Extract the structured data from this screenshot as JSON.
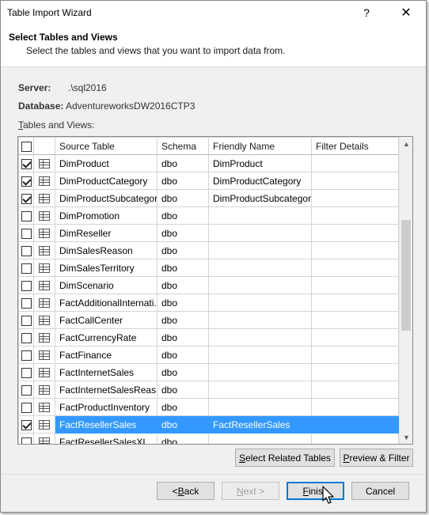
{
  "window": {
    "title": "Table Import Wizard",
    "help_glyph": "?",
    "close_glyph": "✕"
  },
  "header": {
    "title": "Select Tables and Views",
    "subtitle": "Select the tables and views that you want to import data from."
  },
  "info": {
    "server_label": "Server:",
    "server_value": ".\\sql2016",
    "database_label": "Database:",
    "database_value": "AdventureworksDW2016CTP3"
  },
  "tables_label": {
    "prefix": "",
    "accel": "T",
    "rest": "ables and Views:"
  },
  "grid": {
    "columns": [
      "",
      "",
      "Source Table",
      "Schema",
      "Friendly Name",
      "Filter Details"
    ],
    "rows": [
      {
        "checked": true,
        "source": "DimProduct",
        "schema": "dbo",
        "friendly": "DimProduct",
        "filter": "",
        "selected": false
      },
      {
        "checked": true,
        "source": "DimProductCategory",
        "schema": "dbo",
        "friendly": "DimProductCategory",
        "filter": "",
        "selected": false
      },
      {
        "checked": true,
        "source": "DimProductSubcategory",
        "schema": "dbo",
        "friendly": "DimProductSubcategory",
        "filter": "",
        "selected": false
      },
      {
        "checked": false,
        "source": "DimPromotion",
        "schema": "dbo",
        "friendly": "",
        "filter": "",
        "selected": false
      },
      {
        "checked": false,
        "source": "DimReseller",
        "schema": "dbo",
        "friendly": "",
        "filter": "",
        "selected": false
      },
      {
        "checked": false,
        "source": "DimSalesReason",
        "schema": "dbo",
        "friendly": "",
        "filter": "",
        "selected": false
      },
      {
        "checked": false,
        "source": "DimSalesTerritory",
        "schema": "dbo",
        "friendly": "",
        "filter": "",
        "selected": false
      },
      {
        "checked": false,
        "source": "DimScenario",
        "schema": "dbo",
        "friendly": "",
        "filter": "",
        "selected": false
      },
      {
        "checked": false,
        "source": "FactAdditionalInternati...",
        "schema": "dbo",
        "friendly": "",
        "filter": "",
        "selected": false
      },
      {
        "checked": false,
        "source": "FactCallCenter",
        "schema": "dbo",
        "friendly": "",
        "filter": "",
        "selected": false
      },
      {
        "checked": false,
        "source": "FactCurrencyRate",
        "schema": "dbo",
        "friendly": "",
        "filter": "",
        "selected": false
      },
      {
        "checked": false,
        "source": "FactFinance",
        "schema": "dbo",
        "friendly": "",
        "filter": "",
        "selected": false
      },
      {
        "checked": false,
        "source": "FactInternetSales",
        "schema": "dbo",
        "friendly": "",
        "filter": "",
        "selected": false
      },
      {
        "checked": false,
        "source": "FactInternetSalesReas...",
        "schema": "dbo",
        "friendly": "",
        "filter": "",
        "selected": false
      },
      {
        "checked": false,
        "source": "FactProductInventory",
        "schema": "dbo",
        "friendly": "",
        "filter": "",
        "selected": false
      },
      {
        "checked": true,
        "source": "FactResellerSales",
        "schema": "dbo",
        "friendly": "FactResellerSales",
        "filter": "",
        "selected": true
      },
      {
        "checked": false,
        "source": "FactResellerSalesXL",
        "schema": "dbo",
        "friendly": "",
        "filter": "",
        "selected": false
      }
    ]
  },
  "buttons": {
    "select_related": {
      "accel": "S",
      "rest": "elect Related Tables"
    },
    "preview_filter": {
      "accel": "P",
      "rest": "review & Filter"
    },
    "back": {
      "pre": "< ",
      "accel": "B",
      "rest": "ack"
    },
    "next": {
      "accel": "N",
      "rest": "ext >"
    },
    "finish": {
      "accel": "F",
      "rest": "inish"
    },
    "cancel": "Cancel"
  },
  "icons": {
    "table_row_icon": "table-icon",
    "scroll_up": "▲",
    "scroll_down": "▼"
  },
  "colors": {
    "selection": "#3399ff",
    "default_button_border": "#0078d7"
  }
}
